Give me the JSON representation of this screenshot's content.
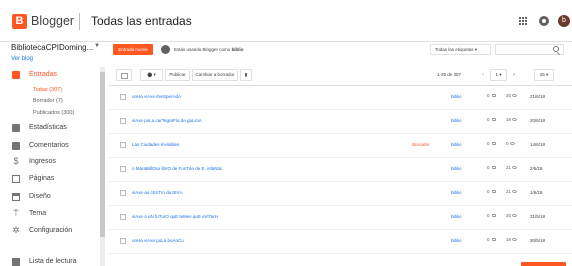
{
  "header": {
    "logo_letter": "B",
    "brand": "Blogger",
    "title": "Todas las entradas",
    "avatar_letter": "b"
  },
  "sidebar": {
    "blog_name": "BibliotecaCPIDoming...",
    "view_blog": "Ver blog",
    "items": [
      {
        "label": "Entradas",
        "icon": "posts-icon"
      },
      {
        "label": "Estadísticas",
        "icon": "stats-icon"
      },
      {
        "label": "Comentarios",
        "icon": "comments-icon"
      },
      {
        "label": "Ingresos",
        "icon": "earnings-icon"
      },
      {
        "label": "Páginas",
        "icon": "pages-icon"
      },
      {
        "label": "Diseño",
        "icon": "layout-icon"
      },
      {
        "label": "Tema",
        "icon": "theme-icon"
      },
      {
        "label": "Configuración",
        "icon": "settings-icon"
      },
      {
        "label": "Lista de lectura",
        "icon": "reading-list-icon"
      }
    ],
    "subitems": [
      {
        "label": "Todas (307)"
      },
      {
        "label": "Borrador (7)"
      },
      {
        "label": "Publicados (300)"
      }
    ]
  },
  "actions": {
    "new_post": "Entrada nueva",
    "using_prefix": "Estás usando Blogger como",
    "using_user": "biblio",
    "label_filter": "Todas las etiquetas",
    "search_placeholder": ""
  },
  "toolbar": {
    "publish": "Publicar",
    "revert": "Cambiar a borrador",
    "range": "1-25 de 307",
    "page": "1",
    "per_page": "25"
  },
  "posts": [
    {
      "title": "unHa viAxe iNeSperAdA",
      "status": "",
      "author": "biblio",
      "comments": "0",
      "views": "20",
      "date": "21/6/18"
    },
    {
      "title": "viAxe poLa carTegraFía de gaLiciA",
      "status": "",
      "author": "biblio",
      "comments": "0",
      "views": "19",
      "date": "20/6/18"
    },
    {
      "title": "Las Ciudades Invisibles",
      "status": "Borrador",
      "author": "biblio",
      "comments": "0",
      "views": "0",
      "date": "14/6/18"
    },
    {
      "title": "o MaraBillOso librO de FonTán de E. infaNtiL",
      "status": "",
      "author": "biblio",
      "comments": "0",
      "views": "21",
      "date": "2/6/18"
    },
    {
      "title": "viAxe ao cEnTro da tErrA",
      "status": "",
      "author": "biblio",
      "comments": "0",
      "views": "21",
      "date": "1/6/18"
    },
    {
      "title": "viAxe a uN fuTurO quE teMes quE eViTarH",
      "status": "",
      "author": "biblio",
      "comments": "0",
      "views": "20",
      "date": "31/5/18"
    },
    {
      "title": "unHa viAxe poLa boAnCu",
      "status": "",
      "author": "biblio",
      "comments": "0",
      "views": "19",
      "date": "30/5/18"
    }
  ],
  "colors": {
    "accent": "#ff5722",
    "link": "#1a73e8"
  }
}
